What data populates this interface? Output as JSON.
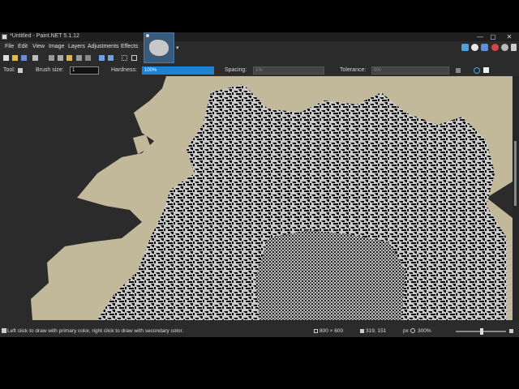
{
  "window": {
    "title": "*Untitled - Paint.NET 5.1.12",
    "minimize_glyph": "—",
    "maximize_glyph": "▢",
    "close_glyph": "✕"
  },
  "menu": {
    "items": [
      "File",
      "Edit",
      "View",
      "Image",
      "Layers",
      "Adjustments",
      "Effects"
    ]
  },
  "toolbar": {
    "icons": [
      "new-icon",
      "open-icon",
      "save-icon",
      "print-icon",
      "cut-icon",
      "copy-icon",
      "paste-icon",
      "crop-icon",
      "deselect-icon",
      "undo-icon",
      "redo-icon",
      "grid-icon"
    ]
  },
  "tabs": {
    "arrow_glyph": "▾"
  },
  "options": {
    "tool_label": "Tool:",
    "brush_size_label": "Brush size:",
    "brush_size_value": "1",
    "hardness_label": "Hardness:",
    "hardness_value": "100%",
    "spacing_label": "Spacing:",
    "spacing_value": "1%",
    "tolerance_label": "Tolerance:",
    "tolerance_value": "0%"
  },
  "status": {
    "hint": "Left click to draw with primary color, right click to draw with secondary color.",
    "image_size": "800 × 600",
    "cursor_pos": "319, 151",
    "units": "px",
    "zoom": "300%"
  },
  "colors": {
    "canvas_bg": "#2b2b2b",
    "land": "#c2b99b",
    "dark": "#0a0a0a",
    "light": "#c9c9c9",
    "accent": "#1e82d4"
  }
}
